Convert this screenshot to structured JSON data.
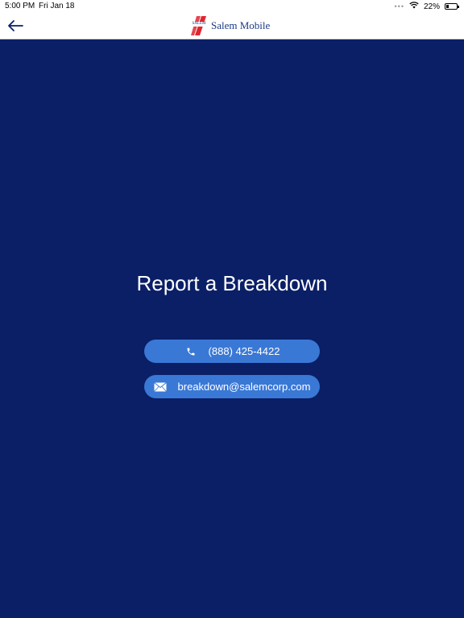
{
  "status_bar": {
    "time": "5:00 PM",
    "date": "Fri Jan 18",
    "battery": "22%",
    "wifi_icon": "wifi-icon",
    "battery_icon": "battery-icon"
  },
  "nav_bar": {
    "back_icon": "arrow-left-icon",
    "logo_text": "SALEM",
    "brand_name": "Salem Mobile"
  },
  "main": {
    "title": "Report a Breakdown",
    "phone": {
      "label": "(888) 425-4422",
      "icon": "phone-icon"
    },
    "email": {
      "label": "breakdown@salemcorp.com",
      "icon": "envelope-icon"
    }
  },
  "colors": {
    "background": "#0a1f66",
    "button": "#3a78d6",
    "logo_red": "#e0262f",
    "logo_blue": "#12327a"
  }
}
